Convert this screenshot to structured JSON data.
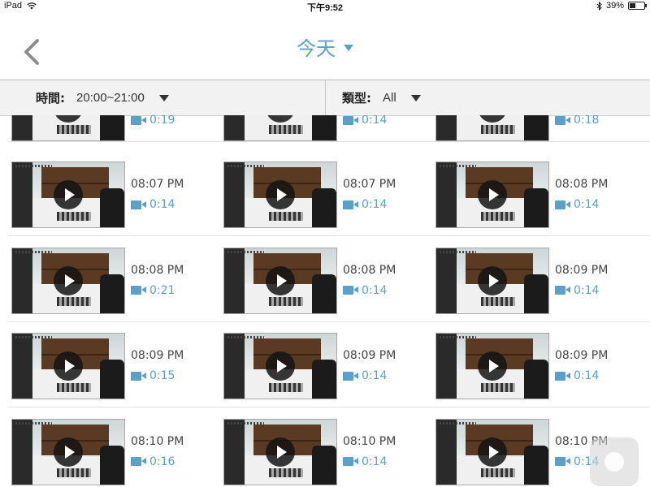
{
  "status_bar": {
    "device": "iPad",
    "time": "下午9:52",
    "battery": "39%",
    "battery_level": 0.39
  },
  "nav": {
    "title": "今天"
  },
  "filters": {
    "time_label": "時間:",
    "time_value": "20:00~21:00",
    "type_label": "類型:",
    "type_value": "All"
  },
  "partial_row": [
    {
      "duration": "0:19"
    },
    {
      "duration": "0:14"
    },
    {
      "duration": "0:18"
    }
  ],
  "rows": [
    [
      {
        "time": "08:07 PM",
        "duration": "0:14"
      },
      {
        "time": "08:07 PM",
        "duration": "0:14"
      },
      {
        "time": "08:08 PM",
        "duration": "0:14"
      }
    ],
    [
      {
        "time": "08:08 PM",
        "duration": "0:21"
      },
      {
        "time": "08:08 PM",
        "duration": "0:14"
      },
      {
        "time": "08:09 PM",
        "duration": "0:14"
      }
    ],
    [
      {
        "time": "08:09 PM",
        "duration": "0:15"
      },
      {
        "time": "08:09 PM",
        "duration": "0:14"
      },
      {
        "time": "08:09 PM",
        "duration": "0:14"
      }
    ],
    [
      {
        "time": "08:10 PM",
        "duration": "0:16"
      },
      {
        "time": "08:10 PM",
        "duration": "0:14"
      },
      {
        "time": "08:10 PM",
        "duration": "0:14"
      }
    ]
  ]
}
